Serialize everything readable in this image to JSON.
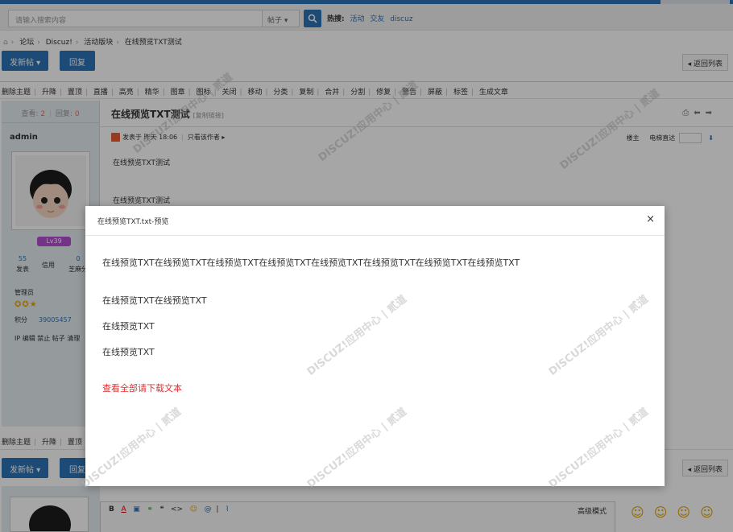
{
  "search": {
    "placeholder": "请输入搜索内容",
    "type_label": "帖子",
    "hot_label": "热搜:",
    "hot_items": [
      "活动",
      "交友",
      "discuz"
    ]
  },
  "breadcrumb": [
    "论坛",
    "Discuz!",
    "活动版块",
    "在线预览TXT测试"
  ],
  "buttons": {
    "new_post": "发新帖",
    "reply": "回复",
    "back_to_list": "返回列表"
  },
  "mod_actions": [
    "删除主题",
    "升降",
    "置顶",
    "直播",
    "高亮",
    "精华",
    "图章",
    "图标",
    "关闭",
    "移动",
    "分类",
    "复制",
    "合并",
    "分割",
    "修复",
    "警告",
    "屏蔽",
    "标签",
    "生成文章"
  ],
  "mod_actions_bottom": [
    "删除主题",
    "升降",
    "置顶"
  ],
  "thread": {
    "views_label": "查看:",
    "views": "2",
    "replies_label": "回复:",
    "replies": "0",
    "title": "在线预览TXT测试",
    "copy_link": "[复制链接]",
    "posted_at": "发表于 昨天 18:06",
    "only_author": "只看该作者",
    "floor_label": "楼主",
    "jump_label": "电梯直达",
    "body_lines": [
      "在线预览TXT测试",
      "在线预览TXT测试"
    ]
  },
  "author": {
    "name": "admin",
    "level_badge": "Lv39",
    "stat1_num": "55",
    "stat1_label": "发表",
    "stat2_label": "信用",
    "stat3_num": "0",
    "stat3_label": "芝麻分",
    "role": "管理员",
    "points_label": "积分",
    "points": "39005457",
    "ip_line": "IP 编辑 禁止 帖子 清理"
  },
  "modal": {
    "title": "在线预览TXT.txt-预览",
    "close": "×",
    "lines": [
      "在线预览TXT在线预览TXT在线预览TXT在线预览TXT在线预览TXT在线预览TXT在线预览TXT在线预览TXT",
      "在线预览TXT在线预览TXT",
      "在线预览TXT",
      "在线预览TXT"
    ],
    "download_link": "查看全部请下载文本"
  },
  "editor": {
    "advanced_mode": "高级模式"
  },
  "colors": {
    "brand_blue": "#2b73b7",
    "link_red": "#e42e2e"
  }
}
